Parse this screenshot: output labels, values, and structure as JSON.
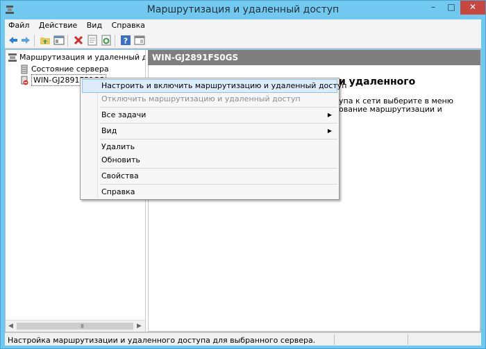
{
  "window": {
    "title": "Маршрутизация и удаленный доступ",
    "controls": {
      "minimize": "–",
      "maximize": "□",
      "close": "✕"
    }
  },
  "menubar": [
    {
      "label": "Файл"
    },
    {
      "label": "Действие"
    },
    {
      "label": "Вид"
    },
    {
      "label": "Справка"
    }
  ],
  "toolbar": {
    "icons": [
      "back-arrow-icon",
      "forward-arrow-icon",
      "folder-up-icon",
      "show-hide-tree-icon",
      "delete-icon",
      "properties-icon",
      "refresh-icon",
      "help-icon",
      "console-icon"
    ]
  },
  "tree": {
    "root": "Маршрутизация и удаленный доступ",
    "items": [
      {
        "label": "Состояние сервера"
      },
      {
        "label": "WIN-GJ2891FS0GS"
      }
    ],
    "scroll_grip": "III"
  },
  "pane": {
    "header": "WIN-GJ2891FS0GS",
    "heading": "и удаленного",
    "text_line1": "упа к сети выберите в меню",
    "text_line2": "ование маршрутизации и"
  },
  "context_menu": {
    "items": [
      {
        "label": "Настроить и включить маршрутизацию и удаленный доступ",
        "state": "highlighted"
      },
      {
        "label": "Отключить маршрутизацию и удаленный доступ",
        "state": "disabled"
      },
      {
        "label": "Все задачи",
        "submenu": "▶"
      },
      {
        "label": "Вид",
        "submenu": "▶"
      },
      {
        "label": "Удалить"
      },
      {
        "label": "Обновить"
      },
      {
        "label": "Свойства"
      },
      {
        "label": "Справка"
      }
    ]
  },
  "statusbar": {
    "text": "Настройка маршрутизации и удаленного доступа для выбранного сервера."
  },
  "colors": {
    "titlebar": "#72c9ef",
    "close_button": "#c7473f",
    "pane_header": "#7f7f7f",
    "menu_highlight": "#dcecfc"
  }
}
